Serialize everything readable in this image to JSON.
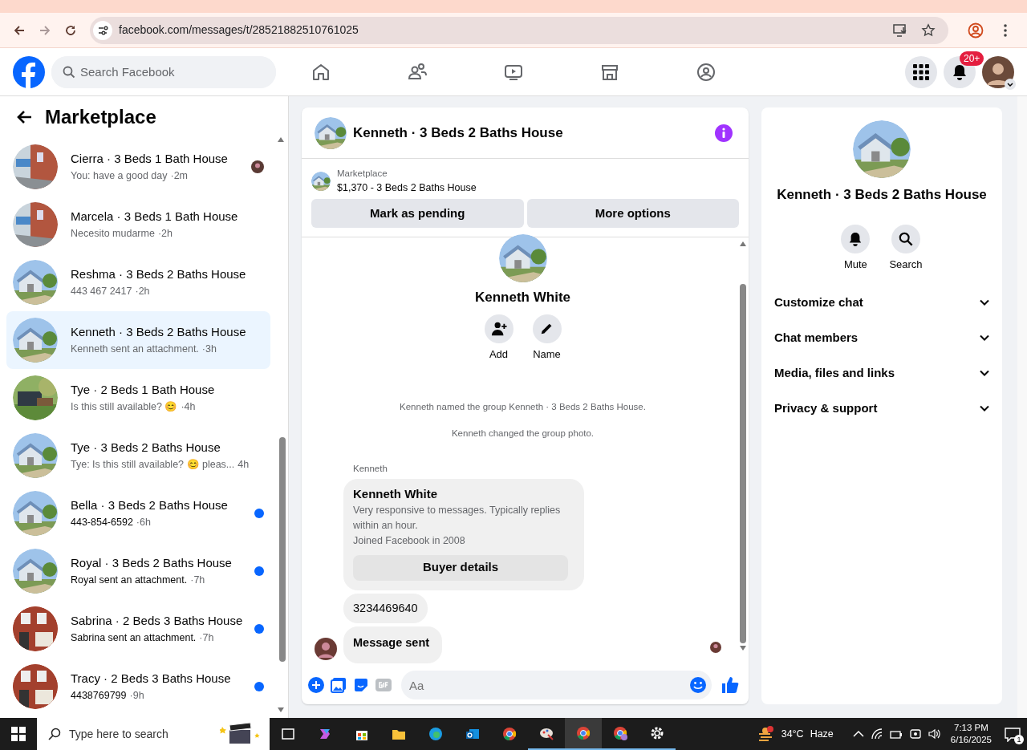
{
  "browser": {
    "url": "facebook.com/messages/t/28521882510761025"
  },
  "header": {
    "search_placeholder": "Search Facebook",
    "notifications_badge": "20+"
  },
  "sidebar": {
    "title": "Marketplace",
    "conversations": [
      {
        "title": "Cierra · 3 Beds 1 Bath House",
        "preview": "You: have a good day",
        "time": "·2m",
        "unread": false,
        "seen": true,
        "selected": false
      },
      {
        "title": "Marcela · 3 Beds 1 Bath House",
        "preview": "Necesito mudarme",
        "time": "·2h",
        "unread": false,
        "seen": false,
        "selected": false
      },
      {
        "title": "Reshma · 3 Beds 2 Baths House",
        "preview": "443 467 2417",
        "time": "·2h",
        "unread": false,
        "seen": false,
        "selected": false
      },
      {
        "title": "Kenneth · 3 Beds 2 Baths House",
        "preview": "Kenneth sent an attachment.",
        "time": "·3h",
        "unread": false,
        "seen": false,
        "selected": true
      },
      {
        "title": "Tye · 2 Beds 1 Bath House",
        "preview": "Is this still available? 😊",
        "time": "·4h",
        "unread": false,
        "seen": false,
        "selected": false
      },
      {
        "title": "Tye · 3 Beds 2 Baths House",
        "preview": "Tye: Is this still available? 😊 pleas...",
        "time": "4h",
        "unread": false,
        "seen": false,
        "selected": false
      },
      {
        "title": "Bella · 3 Beds 2 Baths House",
        "preview": "443-854-6592",
        "time": "·6h",
        "unread": true,
        "seen": false,
        "selected": false
      },
      {
        "title": "Royal · 3 Beds 2 Baths House",
        "preview": "Royal sent an attachment.",
        "time": "·7h",
        "unread": true,
        "seen": false,
        "selected": false
      },
      {
        "title": "Sabrina · 2 Beds 3 Baths House",
        "preview": "Sabrina sent an attachment.",
        "time": "·7h",
        "unread": true,
        "seen": false,
        "selected": false
      },
      {
        "title": "Tracy · 2 Beds 3 Baths House",
        "preview": "4438769799",
        "time": "·9h",
        "unread": true,
        "seen": false,
        "selected": false
      }
    ]
  },
  "chat": {
    "title": "Kenneth · 3 Beds 2 Baths House",
    "listing": {
      "label": "Marketplace",
      "summary": "$1,370 - 3 Beds 2 Baths House",
      "buttons": [
        "Mark as pending",
        "More options"
      ]
    },
    "profile": {
      "name": "Kenneth White",
      "actions": [
        "Add",
        "Name"
      ]
    },
    "events": [
      "Kenneth named the group Kenneth · 3 Beds 2 Baths House.",
      "Kenneth changed the group photo."
    ],
    "sender": "Kenneth",
    "buyer_card": {
      "name": "Kenneth White",
      "lines": [
        "Very responsive to messages. Typically replies within an hour.",
        "Joined Facebook in 2008"
      ],
      "button": "Buyer details"
    },
    "messages": [
      {
        "kind": "text",
        "text": "3234469640"
      },
      {
        "kind": "notice",
        "text": "Message sent"
      }
    ],
    "composer": {
      "placeholder": "Aa"
    }
  },
  "details": {
    "title": "Kenneth · 3 Beds 2 Baths House",
    "actions": [
      "Mute",
      "Search"
    ],
    "sections": [
      {
        "label": "Customize chat",
        "expanded": false
      },
      {
        "label": "Chat members",
        "expanded": false
      },
      {
        "label": "Media, files and links",
        "expanded": false
      },
      {
        "label": "Privacy & support",
        "expanded": false
      }
    ]
  },
  "taskbar": {
    "search_placeholder": "Type here to search",
    "temperature": "34°C",
    "weather": "Haze",
    "time": "7:13 PM",
    "date": "6/16/2025",
    "notifications": "1"
  }
}
